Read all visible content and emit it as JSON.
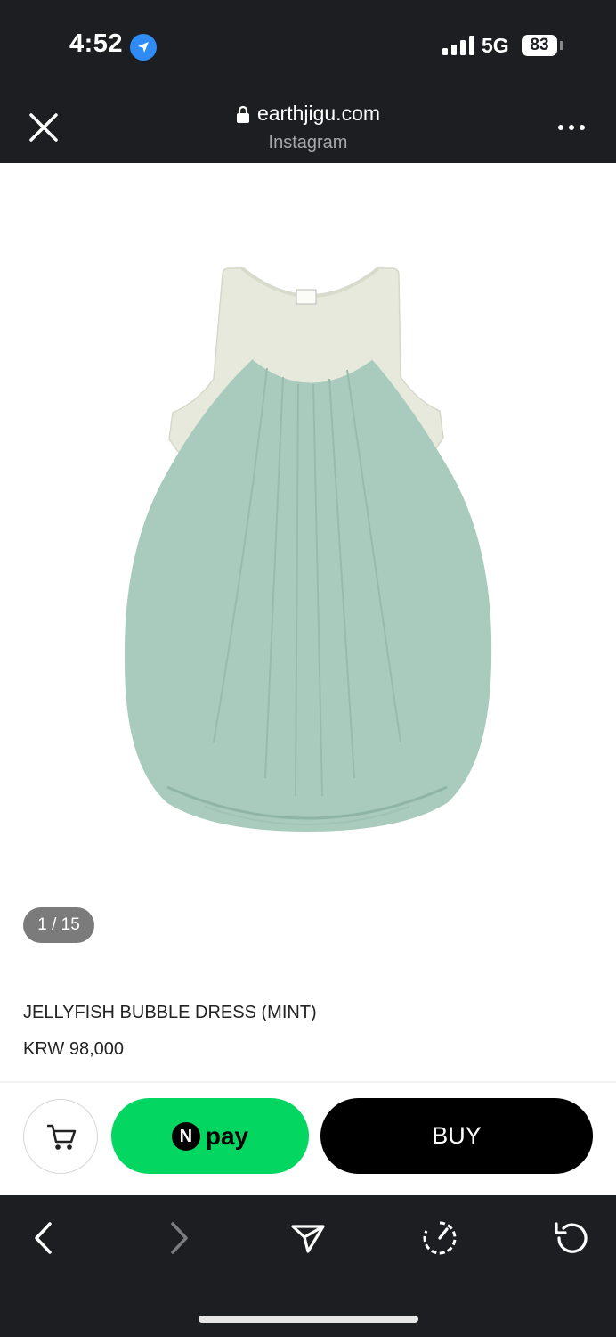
{
  "status_bar": {
    "time": "4:52",
    "network": "5G",
    "battery": "83",
    "icons": [
      "location-arrow-icon",
      "cellular-signal-icon",
      "battery-icon"
    ]
  },
  "browser": {
    "domain": "earthjigu.com",
    "source": "Instagram",
    "icons": [
      "close-icon",
      "lock-icon",
      "more-icon"
    ]
  },
  "product": {
    "image_counter": "1 / 15",
    "name": "JELLYFISH BUBBLE DRESS (MINT)",
    "price": "KRW 98,000"
  },
  "actions": {
    "npay_n": "N",
    "npay_label": "pay",
    "buy_label": "BUY",
    "cart_icon": "cart-icon"
  },
  "bottom_nav": {
    "icons": [
      "back-icon",
      "forward-icon",
      "send-icon",
      "speed-icon",
      "reload-icon"
    ]
  },
  "colors": {
    "dark_bar": "#1c1e21",
    "npay_green": "#03d661",
    "buy_black": "#000000",
    "dress_mint": "#a8cbbd",
    "tank_cream": "#e6e9dc"
  }
}
